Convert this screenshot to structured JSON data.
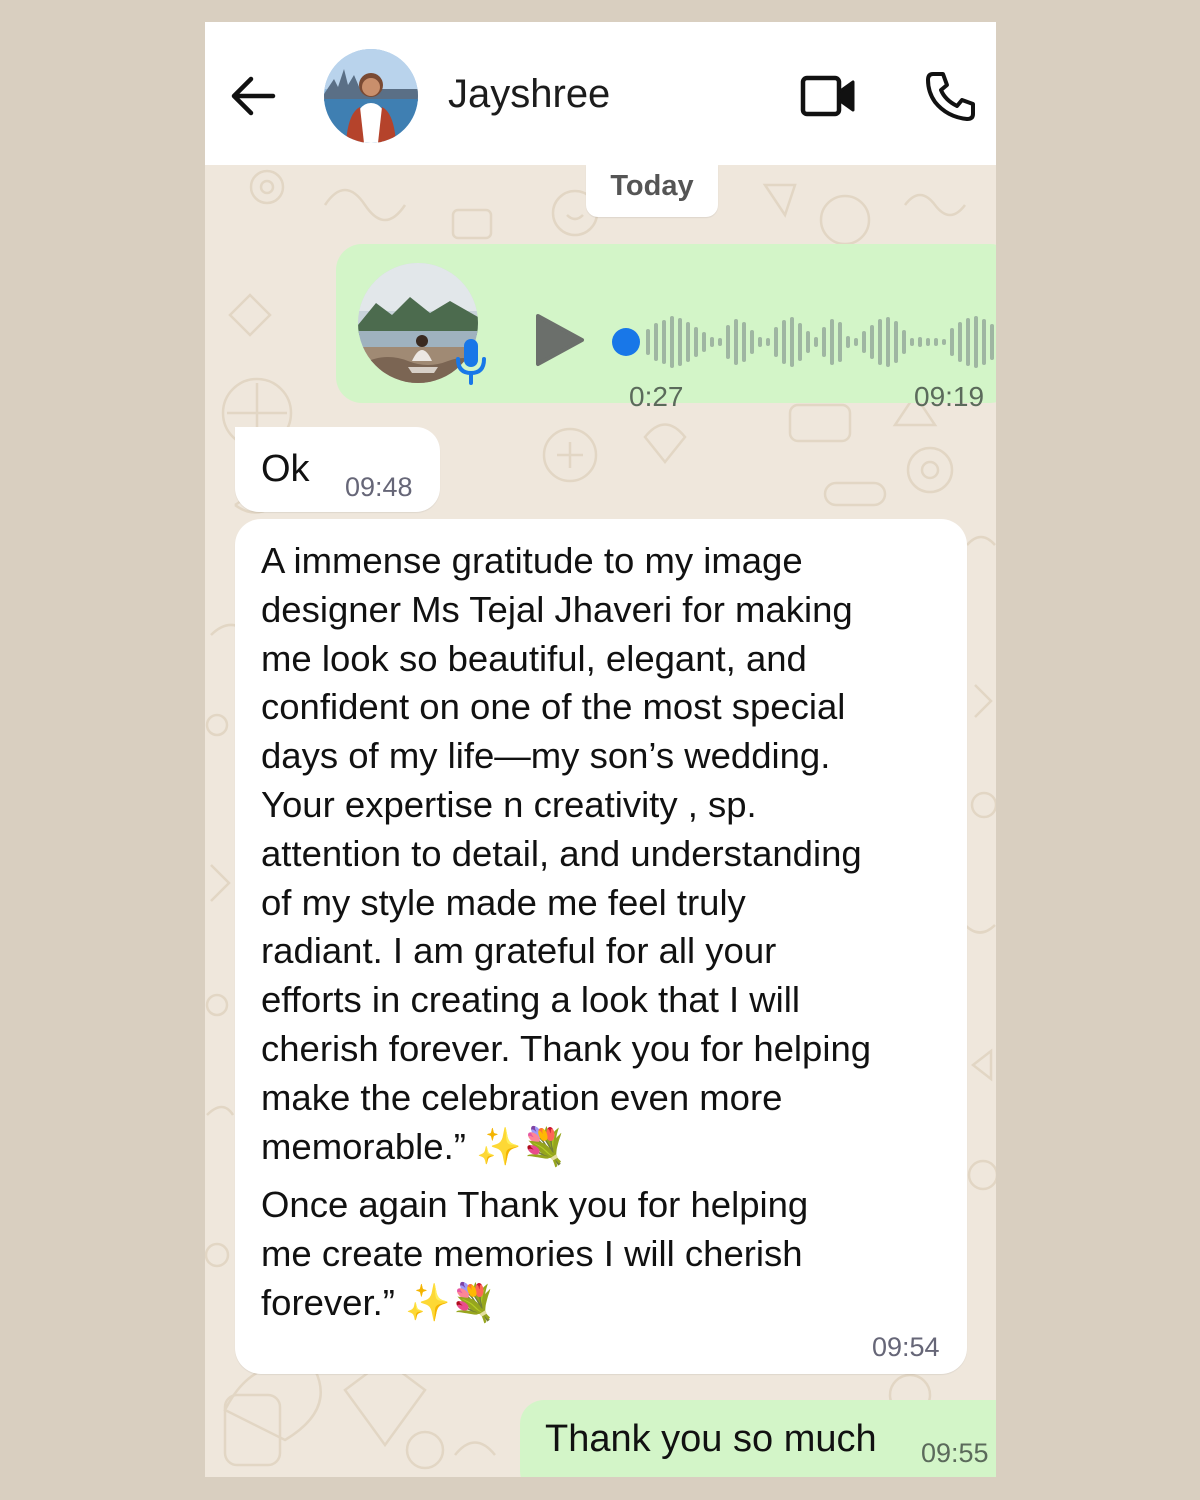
{
  "header": {
    "back_icon": "arrow-left-icon",
    "contact_name": "Jayshree",
    "video_icon": "video-call-icon",
    "call_icon": "phone-icon"
  },
  "chat": {
    "date_label": "Today",
    "voice_message": {
      "duration": "0:27",
      "time": "09:19",
      "progress": 0,
      "play_icon": "play-icon",
      "mic_icon": "microphone-icon"
    },
    "messages": [
      {
        "direction": "incoming",
        "text": "Ok",
        "time": "09:48"
      },
      {
        "direction": "incoming",
        "text": "A immense gratitude to my image\ndesigner Ms Tejal Jhaveri for making\nme look so beautiful, elegant, and\nconfident on one of the most special\ndays of my life—my son’s wedding.\nYour expertise n creativity , sp.\nattention to detail, and understanding\nof my style made me feel truly\nradiant. I am grateful for all your\nefforts in creating a look that I will\ncherish forever. Thank you for helping\nmake the celebration even more\nmemorable.” ✨💐",
        "text_2": "Once again Thank you for helping\nme create memories I will cherish\nforever.” ✨💐",
        "time": "09:54"
      },
      {
        "direction": "outgoing",
        "text": "Thank you so much",
        "time": "09:55"
      }
    ]
  },
  "colors": {
    "outgoing_bubble": "#d3f5c8",
    "incoming_bubble": "#ffffff",
    "chat_background": "#efe7dc",
    "page_background": "#d9cfc0",
    "accent_blue": "#1877e8"
  }
}
